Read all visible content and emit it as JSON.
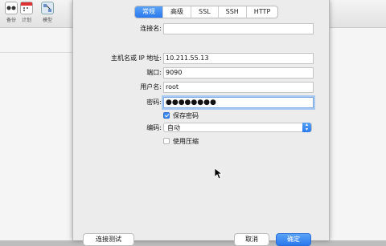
{
  "background_app": {
    "toolbar": [
      {
        "label": "备份",
        "icon": "backup-icon"
      },
      {
        "label": "计划",
        "icon": "calendar-icon"
      },
      {
        "label": "模型",
        "icon": "model-icon"
      }
    ]
  },
  "dialog": {
    "tabs": [
      {
        "label": "常规",
        "active": true
      },
      {
        "label": "高级",
        "active": false
      },
      {
        "label": "SSL",
        "active": false
      },
      {
        "label": "SSH",
        "active": false
      },
      {
        "label": "HTTP",
        "active": false
      }
    ],
    "fields": {
      "connection_name": {
        "label": "连接名:",
        "value": ""
      },
      "host": {
        "label": "主机名或 IP 地址:",
        "value": "10.211.55.13"
      },
      "port": {
        "label": "端口:",
        "value": "9090"
      },
      "username": {
        "label": "用户名:",
        "value": "root"
      },
      "password": {
        "label": "密码:",
        "value": "●●●●●●●●"
      }
    },
    "save_password": {
      "label": "保存密码",
      "checked": true
    },
    "encoding": {
      "label": "编码:",
      "selected": "自动"
    },
    "use_compression": {
      "label": "使用压缩",
      "checked": false
    },
    "buttons": {
      "test": "连接测试",
      "cancel": "取消",
      "ok": "确定"
    }
  },
  "colors": {
    "accent": "#2a78ee",
    "focus_ring": "#a9c9f3"
  }
}
